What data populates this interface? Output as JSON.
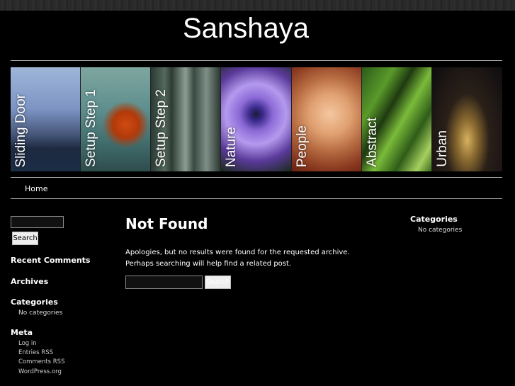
{
  "site": {
    "title": "Sanshaya"
  },
  "slider": {
    "panels": [
      {
        "label": "Sliding Door"
      },
      {
        "label": "Setup Step 1"
      },
      {
        "label": "Setup Step 2"
      },
      {
        "label": "Nature"
      },
      {
        "label": "People"
      },
      {
        "label": "Abstract"
      },
      {
        "label": "Urban"
      }
    ]
  },
  "nav": {
    "items": [
      {
        "label": "Home"
      }
    ]
  },
  "left_sidebar": {
    "search_button": "Search",
    "recent_comments": "Recent Comments",
    "archives": "Archives",
    "categories": {
      "heading": "Categories",
      "empty": "No categories"
    },
    "meta": {
      "heading": "Meta",
      "links": [
        "Log in",
        "Entries RSS",
        "Comments RSS",
        "WordPress.org"
      ]
    }
  },
  "main": {
    "title": "Not Found",
    "message": "Apologies, but no results were found for the requested archive. Perhaps searching will help find a related post.",
    "search_button": "Search"
  },
  "right_sidebar": {
    "categories": {
      "heading": "Categories",
      "empty": "No categories"
    }
  }
}
